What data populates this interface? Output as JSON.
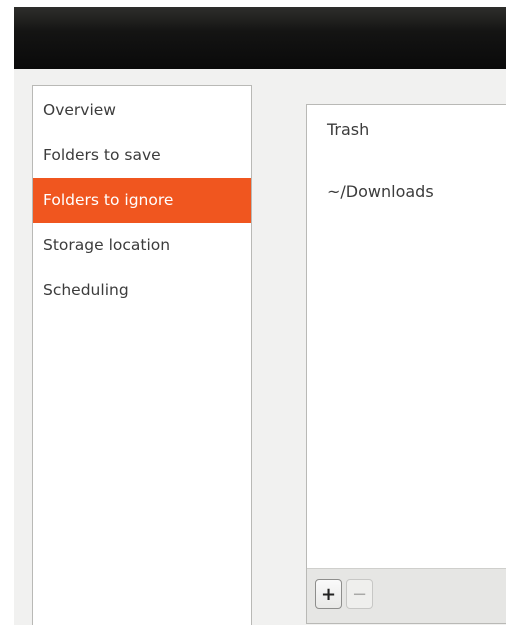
{
  "sidebar": {
    "items": [
      {
        "label": "Overview",
        "selected": false
      },
      {
        "label": "Folders to save",
        "selected": false
      },
      {
        "label": "Folders to ignore",
        "selected": true
      },
      {
        "label": "Storage location",
        "selected": false
      },
      {
        "label": "Scheduling",
        "selected": false
      }
    ]
  },
  "ignore_list": {
    "folders": [
      "Trash",
      "~/Downloads"
    ]
  },
  "toolbar": {
    "add_label": "+",
    "remove_label": "−"
  },
  "colors": {
    "accent": "#f0561f",
    "titlebar": "#141413",
    "window_bg": "#f1f1f0"
  }
}
